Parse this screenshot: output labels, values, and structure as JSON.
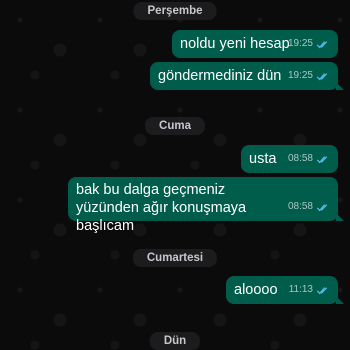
{
  "day_separators": {
    "thursday": "Perşembe",
    "friday": "Cuma",
    "saturday": "Cumartesi",
    "sunday": "Dün"
  },
  "messages": [
    {
      "text": "noldu yeni hesap",
      "time": "19:25",
      "status": "read"
    },
    {
      "text": "göndermediniz dün",
      "time": "19:25",
      "status": "read"
    },
    {
      "text": "usta",
      "time": "08:58",
      "status": "read"
    },
    {
      "text": "bak bu dalga geçmeniz yüzünden ağır konuşmaya başlıcam",
      "time": "08:58",
      "status": "read"
    },
    {
      "text": "aloooo",
      "time": "11:13",
      "status": "read"
    }
  ],
  "colors": {
    "outgoing_bubble": "#005c4b",
    "read_tick": "#53bdeb",
    "background": "#0b0b0b",
    "day_separator": "#1c1c1e"
  },
  "icons": {
    "status": "double-check-icon"
  }
}
